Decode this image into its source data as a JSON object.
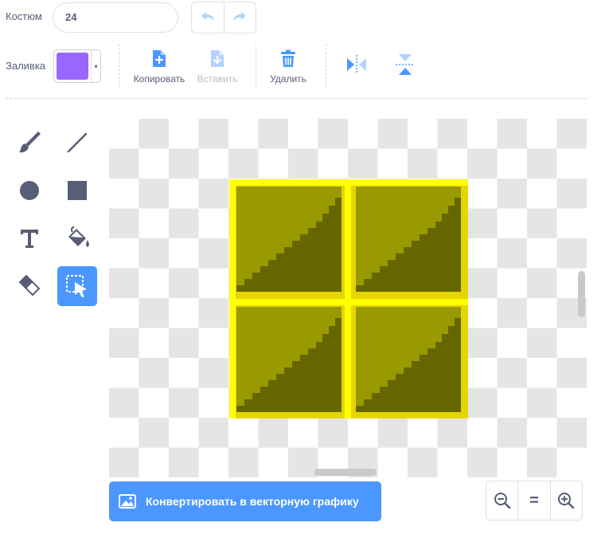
{
  "costume": {
    "label": "Костюм",
    "value": "24"
  },
  "fill": {
    "label": "Заливка",
    "color": "#9966ff",
    "arrow": "▾"
  },
  "actions": {
    "copy": "Копировать",
    "paste": "Вставить",
    "delete": "Удалить"
  },
  "convert": {
    "label": "Конвертировать в векторную графику"
  },
  "zoom": {
    "reset": "="
  },
  "colors": {
    "accent": "#4c97ff",
    "text": "#575e75",
    "sprite_border": "#ffff00",
    "sprite_light": "#999900",
    "sprite_dark": "#666600"
  },
  "icons": {
    "undo": "undo-icon",
    "redo": "redo-icon",
    "copy": "copy-icon",
    "paste": "paste-icon",
    "delete": "trash-icon",
    "flip_h": "flip-horizontal-icon",
    "flip_v": "flip-vertical-icon",
    "brush": "brush-icon",
    "line": "line-icon",
    "circle": "circle-icon",
    "rect": "rectangle-icon",
    "text": "text-icon",
    "fill": "fill-bucket-icon",
    "eraser": "eraser-icon",
    "select": "select-icon",
    "image": "image-icon",
    "zoom_out": "zoom-out-icon",
    "zoom_in": "zoom-in-icon"
  }
}
